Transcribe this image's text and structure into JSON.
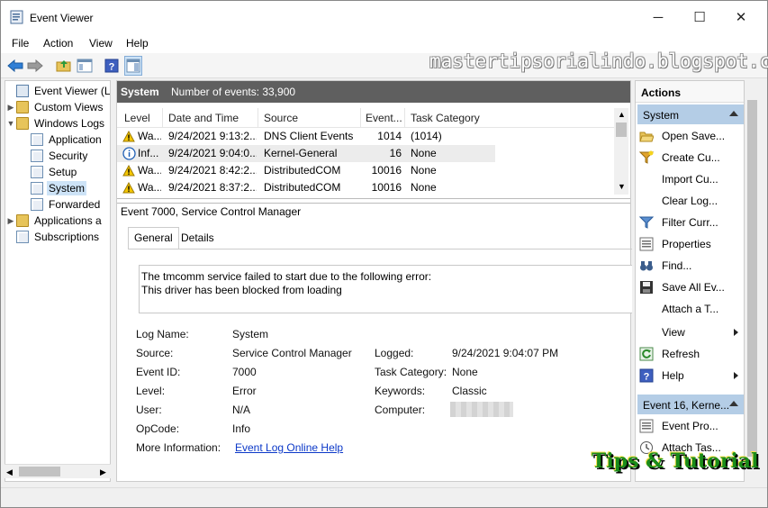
{
  "window": {
    "title": "Event Viewer",
    "minimize": "─",
    "maximize": "☐",
    "close": "✕"
  },
  "menu": [
    "File",
    "Action",
    "View",
    "Help"
  ],
  "watermark": "mastertipsorialindo.blogspot.com",
  "logo": "Tips & Tutorial",
  "tree": {
    "root": "Event Viewer (Loc",
    "custom_views": "Custom Views",
    "windows_logs": "Windows Logs",
    "application": "Application",
    "security": "Security",
    "setup": "Setup",
    "system": "System",
    "forwarded": "Forwarded",
    "applications": "Applications a",
    "subscriptions": "Subscriptions"
  },
  "center": {
    "log_name": "System",
    "event_count": "Number of events: 33,900",
    "columns": [
      "Level",
      "Date and Time",
      "Source",
      "Event...",
      "Task Category"
    ],
    "rows": [
      {
        "level": "Wa...",
        "date": "9/24/2021 9:13:2...",
        "source": "DNS Client Events",
        "event": "1014",
        "task": "(1014)"
      },
      {
        "level": "Inf...",
        "date": "9/24/2021 9:04:0...",
        "source": "Kernel-General",
        "event": "16",
        "task": "None"
      },
      {
        "level": "Wa...",
        "date": "9/24/2021 8:42:2...",
        "source": "DistributedCOM",
        "event": "10016",
        "task": "None"
      },
      {
        "level": "Wa...",
        "date": "9/24/2021 8:37:2...",
        "source": "DistributedCOM",
        "event": "10016",
        "task": "None"
      }
    ],
    "detail_title": "Event 7000, Service Control Manager",
    "tabs": {
      "general": "General",
      "details": "Details"
    },
    "message_line1": "The tmcomm service failed to start due to the following error:",
    "message_line2": "This driver has been blocked from loading",
    "fields": {
      "log_name_label": "Log Name:",
      "log_name": "System",
      "source_label": "Source:",
      "source": "Service Control Manager",
      "logged_label": "Logged:",
      "logged": "9/24/2021 9:04:07 PM",
      "event_id_label": "Event ID:",
      "event_id": "7000",
      "task_label": "Task Category:",
      "task": "None",
      "level_label": "Level:",
      "level": "Error",
      "keywords_label": "Keywords:",
      "keywords": "Classic",
      "user_label": "User:",
      "user": "N/A",
      "computer_label": "Computer:",
      "opcode_label": "OpCode:",
      "opcode": "Info",
      "more_label": "More Information:",
      "more_link": "Event Log Online Help"
    }
  },
  "actions": {
    "header": "Actions",
    "section1": "System",
    "items1": [
      "Open Save...",
      "Create Cu...",
      "Import Cu...",
      "Clear Log...",
      "Filter Curr...",
      "Properties",
      "Find...",
      "Save All Ev...",
      "Attach a T...",
      "View",
      "Refresh",
      "Help"
    ],
    "section2": "Event 16, Kerne...",
    "items2": [
      "Event Pro...",
      "Attach Tas..."
    ]
  },
  "colors": {
    "accent": "#b4cde6",
    "header_bg": "#5f5f5f",
    "link": "#0b38c8"
  }
}
